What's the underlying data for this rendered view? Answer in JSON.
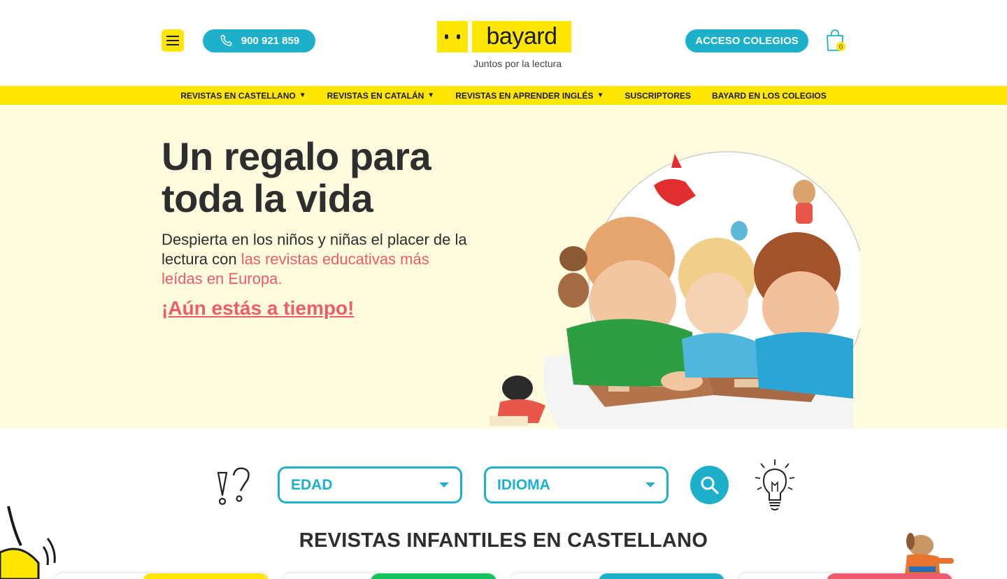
{
  "header": {
    "phone": "900 921 859",
    "logo_text": "bayard",
    "tagline": "Juntos por la lectura",
    "access_label": "ACCESO COLEGIOS",
    "cart_count": "0"
  },
  "nav": {
    "items": [
      {
        "label": "REVISTAS EN CASTELLANO",
        "dropdown": "▼"
      },
      {
        "label": "REVISTAS EN CATALÁN",
        "dropdown": "▼"
      },
      {
        "label": "REVISTAS EN APRENDER INGLÉS",
        "dropdown": "▼"
      },
      {
        "label": "SUSCRIPTORES"
      },
      {
        "label": "BAYARD EN LOS COLEGIOS"
      }
    ]
  },
  "hero": {
    "title": "Un regalo para toda la vida",
    "text_plain": "Despierta en los niños y niñas el placer de la lectura con ",
    "text_highlight": "las revistas educativas más leídas en Europa.",
    "cta": "¡Aún estás a tiempo!"
  },
  "filter": {
    "age_label": "EDAD",
    "language_label": "IDIOMA"
  },
  "section": {
    "title": "REVISTAS INFANTILES EN CASTELLANO"
  },
  "colors": {
    "brand_yellow": "#ffe600",
    "accent_blue": "#1cb0cb",
    "accent_pink": "#ee5a6e",
    "hero_bg": "#fffbdf",
    "card_stripes": [
      "#ffe600",
      "#14c35a",
      "#1cb0cb",
      "#ee5a6e"
    ]
  }
}
